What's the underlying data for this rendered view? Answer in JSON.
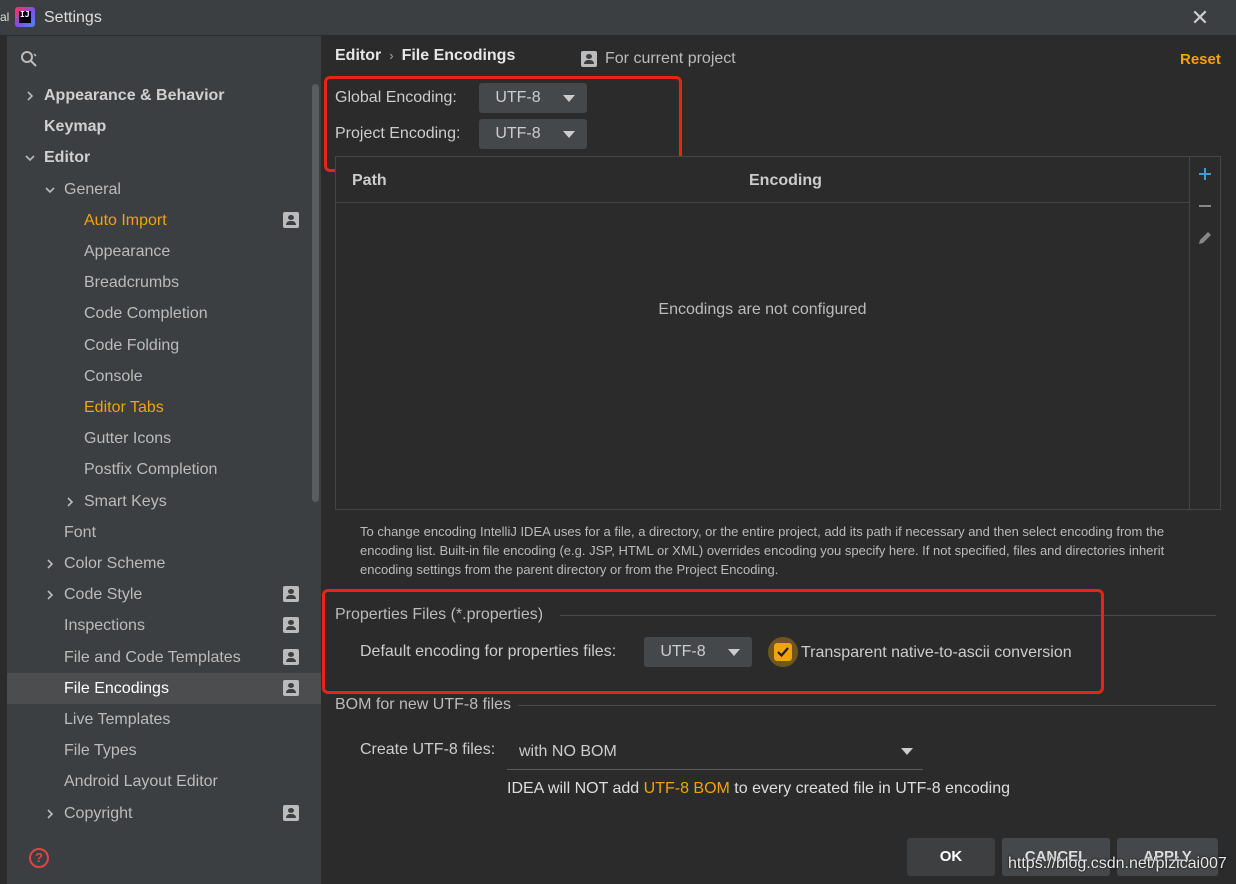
{
  "window": {
    "title": "Settings",
    "edge_fragment": "al",
    "logo_text": "IJ"
  },
  "sidebar": {
    "items": [
      {
        "label": "Appearance & Behavior",
        "indent": 0,
        "chevron": "right",
        "style": "bold",
        "project": false
      },
      {
        "label": "Keymap",
        "indent": 0,
        "chevron": "none",
        "style": "bold",
        "project": false
      },
      {
        "label": "Editor",
        "indent": 0,
        "chevron": "down",
        "style": "bold",
        "project": false
      },
      {
        "label": "General",
        "indent": 1,
        "chevron": "down",
        "style": "normal",
        "project": false
      },
      {
        "label": "Auto Import",
        "indent": 2,
        "chevron": "none",
        "style": "orange",
        "project": true
      },
      {
        "label": "Appearance",
        "indent": 2,
        "chevron": "none",
        "style": "normal",
        "project": false
      },
      {
        "label": "Breadcrumbs",
        "indent": 2,
        "chevron": "none",
        "style": "normal",
        "project": false
      },
      {
        "label": "Code Completion",
        "indent": 2,
        "chevron": "none",
        "style": "normal",
        "project": false
      },
      {
        "label": "Code Folding",
        "indent": 2,
        "chevron": "none",
        "style": "normal",
        "project": false
      },
      {
        "label": "Console",
        "indent": 2,
        "chevron": "none",
        "style": "normal",
        "project": false
      },
      {
        "label": "Editor Tabs",
        "indent": 2,
        "chevron": "none",
        "style": "orange",
        "project": false
      },
      {
        "label": "Gutter Icons",
        "indent": 2,
        "chevron": "none",
        "style": "normal",
        "project": false
      },
      {
        "label": "Postfix Completion",
        "indent": 2,
        "chevron": "none",
        "style": "normal",
        "project": false
      },
      {
        "label": "Smart Keys",
        "indent": 2,
        "chevron": "right",
        "style": "normal",
        "project": false
      },
      {
        "label": "Font",
        "indent": 1,
        "chevron": "none",
        "style": "normal",
        "project": false
      },
      {
        "label": "Color Scheme",
        "indent": 1,
        "chevron": "right",
        "style": "normal",
        "project": false
      },
      {
        "label": "Code Style",
        "indent": 1,
        "chevron": "right",
        "style": "normal",
        "project": true
      },
      {
        "label": "Inspections",
        "indent": 1,
        "chevron": "none",
        "style": "normal",
        "project": true
      },
      {
        "label": "File and Code Templates",
        "indent": 1,
        "chevron": "none",
        "style": "normal",
        "project": true
      },
      {
        "label": "File Encodings",
        "indent": 1,
        "chevron": "none",
        "style": "selected",
        "project": true
      },
      {
        "label": "Live Templates",
        "indent": 1,
        "chevron": "none",
        "style": "normal",
        "project": false
      },
      {
        "label": "File Types",
        "indent": 1,
        "chevron": "none",
        "style": "normal",
        "project": false
      },
      {
        "label": "Android Layout Editor",
        "indent": 1,
        "chevron": "none",
        "style": "normal",
        "project": false
      },
      {
        "label": "Copyright",
        "indent": 1,
        "chevron": "right",
        "style": "normal",
        "project": true
      }
    ]
  },
  "header": {
    "breadcrumb_parent": "Editor",
    "breadcrumb_sep": "›",
    "breadcrumb_current": "File Encodings",
    "scope_label": "For current project",
    "reset_label": "Reset"
  },
  "encodings": {
    "global_label": "Global Encoding:",
    "global_value": "UTF-8",
    "project_label": "Project Encoding:",
    "project_value": "UTF-8"
  },
  "table": {
    "col_path": "Path",
    "col_encoding": "Encoding",
    "empty_text": "Encodings are not configured"
  },
  "description": "To change encoding IntelliJ IDEA uses for a file, a directory, or the entire project, add its path if necessary and then select encoding from the encoding list. Built-in file encoding (e.g. JSP, HTML or XML) overrides encoding you specify here. If not specified, files and directories inherit encoding settings from the parent directory or from the Project Encoding.",
  "properties": {
    "section_title": "Properties Files (*.properties)",
    "default_label": "Default encoding for properties files:",
    "default_value": "UTF-8",
    "transparent_label": "Transparent native-to-ascii conversion",
    "transparent_checked": true
  },
  "bom": {
    "section_title": "BOM for new UTF-8 files",
    "create_label": "Create UTF-8 files:",
    "create_value": "with NO BOM",
    "note_prefix": "IDEA will NOT add ",
    "note_accent": "UTF-8 BOM",
    "note_suffix": " to every created file in UTF-8 encoding"
  },
  "buttons": {
    "ok": "OK",
    "cancel": "CANCEL",
    "apply": "APPLY"
  },
  "watermark": "https://blog.csdn.net/pizicai007",
  "colors": {
    "accent": "#f0a30a",
    "highlight": "#e8241a",
    "background": "#2b2b2b",
    "sidebar": "#3c3f41"
  }
}
